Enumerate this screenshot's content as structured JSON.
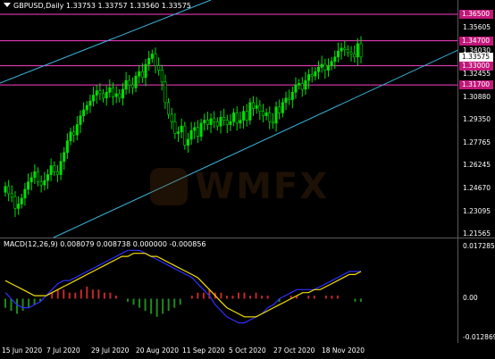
{
  "header": {
    "symbol_line": "GBPUSD,Daily  1.33753 1.33757 1.33560 1.33575",
    "macd_line": "MACD(12,26,9) 0.008079 0.008738 0.000000 -0.000856"
  },
  "price_axis": {
    "labels": [
      "1.35605",
      "1.34030",
      "1.32455",
      "1.30880",
      "1.29350",
      "1.27765",
      "1.26245",
      "1.24670",
      "1.23095",
      "1.21565"
    ],
    "level_tags": [
      {
        "text": "1.36500",
        "color": "#c2177a"
      },
      {
        "text": "1.34700",
        "color": "#c2177a"
      },
      {
        "text": "1.33575",
        "color": "#ffffff"
      },
      {
        "text": "1.33000",
        "color": "#c2177a"
      },
      {
        "text": "1.31700",
        "color": "#c2177a"
      }
    ]
  },
  "macd_axis": {
    "labels": [
      "0.017285",
      "0.00",
      "-0.012869"
    ]
  },
  "time_axis": {
    "labels": [
      "15 Jun 2020",
      "7 Jul 2020",
      "29 Jul 2020",
      "20 Aug 2020",
      "11 Sep 2020",
      "5 Oct 2020",
      "27 Oct 2020",
      "18 Nov 2020"
    ]
  },
  "watermark": {
    "text": "WMFX",
    "logo": "wikifx-logo"
  },
  "colors": {
    "bull": "#00e000",
    "line_h": "#ff3ec8",
    "channel": "#3cb8e0",
    "macd_hist_pos": "#c62828",
    "macd_hist_neg": "#1e8c1e",
    "macd_signal": "#f5e000",
    "macd_main": "#3030ff"
  },
  "chart_data": {
    "type": "candlestick",
    "symbol": "GBPUSD",
    "timeframe": "Daily",
    "last": {
      "open": 1.33753,
      "high": 1.33757,
      "low": 1.3356,
      "close": 1.33575
    },
    "ylim": [
      1.21565,
      1.365
    ],
    "horizontal_levels": [
      1.365,
      1.347,
      1.33,
      1.317
    ],
    "closes": [
      1.248,
      1.243,
      1.241,
      1.233,
      1.236,
      1.24,
      1.246,
      1.251,
      1.254,
      1.258,
      1.251,
      1.249,
      1.252,
      1.256,
      1.262,
      1.258,
      1.256,
      1.265,
      1.271,
      1.279,
      1.285,
      1.283,
      1.29,
      1.296,
      1.3,
      1.303,
      1.306,
      1.31,
      1.313,
      1.311,
      1.308,
      1.312,
      1.315,
      1.309,
      1.311,
      1.308,
      1.314,
      1.32,
      1.317,
      1.315,
      1.323,
      1.326,
      1.322,
      1.331,
      1.335,
      1.338,
      1.33,
      1.327,
      1.319,
      1.305,
      1.297,
      1.292,
      1.284,
      1.285,
      1.289,
      1.276,
      1.28,
      1.286,
      1.288,
      1.282,
      1.291,
      1.293,
      1.29,
      1.294,
      1.292,
      1.289,
      1.295,
      1.293,
      1.29,
      1.292,
      1.298,
      1.291,
      1.293,
      1.299,
      1.293,
      1.305,
      1.301,
      1.303,
      1.299,
      1.296,
      1.298,
      1.292,
      1.291,
      1.302,
      1.298,
      1.305,
      1.308,
      1.307,
      1.312,
      1.317,
      1.318,
      1.314,
      1.32,
      1.324,
      1.323,
      1.326,
      1.329,
      1.331,
      1.327,
      1.33,
      1.333,
      1.336,
      1.34,
      1.342,
      1.341,
      1.339,
      1.338,
      1.336,
      1.345,
      1.336
    ],
    "macd_main": [
      0.002,
      0.0,
      -0.002,
      -0.003,
      -0.003,
      -0.002,
      -0.001,
      0.001,
      0.003,
      0.005,
      0.006,
      0.006,
      0.007,
      0.008,
      0.009,
      0.01,
      0.011,
      0.012,
      0.013,
      0.014,
      0.015,
      0.016,
      0.016,
      0.016,
      0.015,
      0.014,
      0.013,
      0.012,
      0.011,
      0.01,
      0.009,
      0.008,
      0.007,
      0.005,
      0.003,
      0.001,
      -0.002,
      -0.004,
      -0.006,
      -0.007,
      -0.008,
      -0.008,
      -0.007,
      -0.006,
      -0.005,
      -0.003,
      -0.002,
      0.0,
      0.001,
      0.002,
      0.003,
      0.003,
      0.003,
      0.003,
      0.004,
      0.005,
      0.006,
      0.007,
      0.008,
      0.009,
      0.009,
      0.009
    ],
    "macd_signal": [
      0.006,
      0.005,
      0.004,
      0.003,
      0.002,
      0.001,
      0.001,
      0.001,
      0.002,
      0.003,
      0.004,
      0.005,
      0.006,
      0.007,
      0.008,
      0.009,
      0.01,
      0.011,
      0.012,
      0.013,
      0.014,
      0.014,
      0.015,
      0.015,
      0.015,
      0.014,
      0.014,
      0.013,
      0.012,
      0.011,
      0.01,
      0.009,
      0.008,
      0.007,
      0.005,
      0.003,
      0.001,
      -0.001,
      -0.003,
      -0.004,
      -0.005,
      -0.006,
      -0.006,
      -0.006,
      -0.005,
      -0.004,
      -0.003,
      -0.002,
      -0.001,
      0.0,
      0.001,
      0.002,
      0.002,
      0.003,
      0.003,
      0.004,
      0.005,
      0.006,
      0.007,
      0.008,
      0.008,
      0.009
    ],
    "macd_hist": [
      -0.003,
      -0.004,
      -0.005,
      -0.004,
      -0.003,
      -0.002,
      -0.001,
      0.0,
      0.002,
      0.003,
      0.003,
      0.002,
      0.002,
      0.003,
      0.004,
      0.003,
      0.003,
      0.002,
      0.002,
      0.001,
      0.0,
      -0.001,
      -0.002,
      -0.003,
      -0.004,
      -0.005,
      -0.006,
      -0.005,
      -0.004,
      -0.003,
      -0.002,
      0.0,
      0.001,
      0.002,
      0.002,
      0.003,
      0.002,
      0.002,
      0.001,
      0.001,
      0.002,
      0.002,
      0.001,
      0.002,
      0.001,
      0.001,
      0.0,
      -0.001,
      0.0,
      0.001,
      0.001,
      0.0,
      0.001,
      0.001,
      0.0,
      0.001,
      0.001,
      0.001,
      0.0,
      0.0,
      -0.001,
      -0.001
    ]
  }
}
